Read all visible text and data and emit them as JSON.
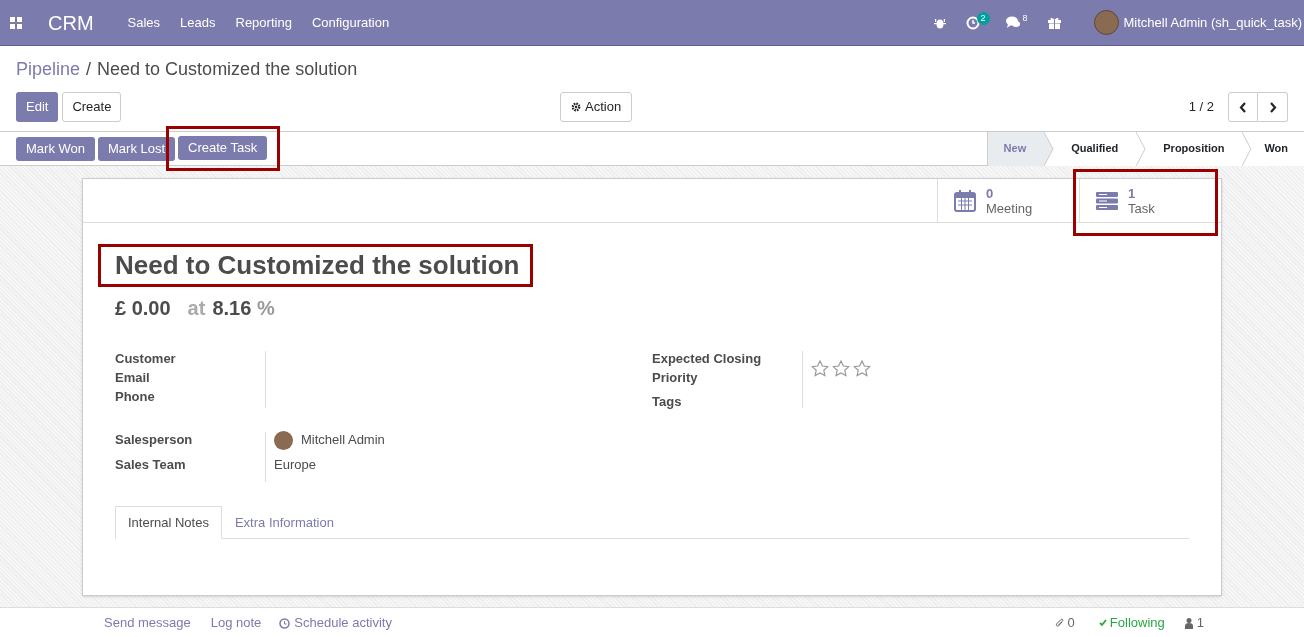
{
  "navbar": {
    "app": "CRM",
    "menu": [
      "Sales",
      "Leads",
      "Reporting",
      "Configuration"
    ],
    "activity_count": "2",
    "message_count": "8",
    "user": "Mitchell Admin (sh_quick_task)"
  },
  "breadcrumb": {
    "parent": "Pipeline",
    "separator": "/",
    "current": "Need to Customized the solution"
  },
  "buttons": {
    "edit": "Edit",
    "create": "Create",
    "action": "Action"
  },
  "pager": "1 / 2",
  "header_buttons": [
    {
      "label": "Mark Won",
      "highlighted": false
    },
    {
      "label": "Mark Lost",
      "highlighted": false
    },
    {
      "label": "Create Task",
      "highlighted": true
    }
  ],
  "stages": [
    {
      "label": "New",
      "selected": true
    },
    {
      "label": "Qualified",
      "selected": false
    },
    {
      "label": "Proposition",
      "selected": false
    },
    {
      "label": "Won",
      "selected": false
    }
  ],
  "smart_buttons": [
    {
      "kind": "calendar",
      "count": "0",
      "label": "Meeting",
      "highlighted": false
    },
    {
      "kind": "task",
      "count": "1",
      "label": "Task",
      "highlighted": true
    }
  ],
  "title": "Need to Customized the solution",
  "revenue": "£ 0.00",
  "at": "at",
  "probability": "8.16",
  "percent": "%",
  "left_fields": [
    {
      "label": "Customer"
    },
    {
      "label": "Email"
    },
    {
      "label": "Phone"
    }
  ],
  "right_fields": [
    {
      "label": "Expected Closing"
    },
    {
      "label": "Priority",
      "stars": 0
    },
    {
      "label": "Tags"
    }
  ],
  "salesperson": {
    "label": "Salesperson",
    "value": "Mitchell Admin"
  },
  "sales_team": {
    "label": "Sales Team",
    "value": "Europe"
  },
  "notebook_tabs": [
    {
      "label": "Internal Notes",
      "selected": true
    },
    {
      "label": "Extra Information",
      "selected": false
    }
  ],
  "chatter": {
    "send_message": "Send message",
    "log_note": "Log note",
    "schedule_activity": "Schedule activity",
    "attachments": "0",
    "following": "Following",
    "followers": "1"
  }
}
